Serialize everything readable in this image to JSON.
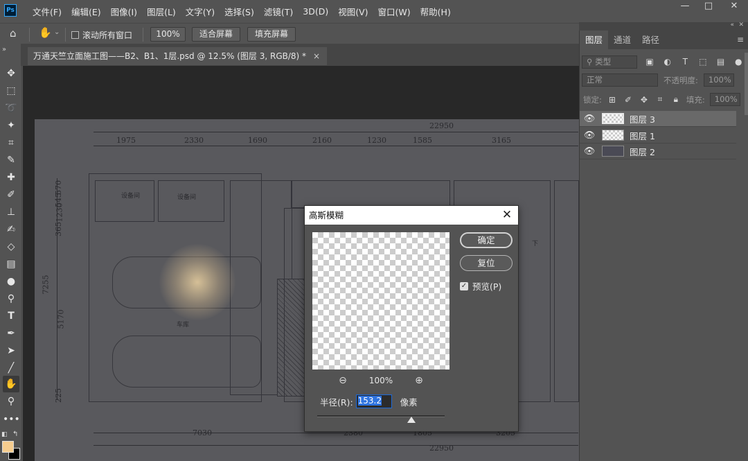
{
  "app": {
    "logo": "Ps"
  },
  "menu": [
    "文件(F)",
    "编辑(E)",
    "图像(I)",
    "图层(L)",
    "文字(Y)",
    "选择(S)",
    "滤镜(T)",
    "3D(D)",
    "视图(V)",
    "窗口(W)",
    "帮助(H)"
  ],
  "window_controls": {
    "minimize": "—",
    "restore": "□",
    "close": "✕"
  },
  "options_bar": {
    "scroll_all_label": "滚动所有窗口",
    "zoom_value": "100%",
    "fit_screen": "适合屏幕",
    "fill_screen": "填充屏幕"
  },
  "document_tab": {
    "title": "万通天竺立面施工图——B2、B1、1层.psd @ 12.5% (图层 3, RGB/8) *",
    "close": "×"
  },
  "toolbar": {
    "expand": "»",
    "tools": [
      "move-tool",
      "marquee-tool",
      "lasso-tool",
      "magic-wand-tool",
      "crop-tool",
      "eyedropper-tool",
      "healing-brush-tool",
      "brush-tool",
      "stamp-tool",
      "history-brush-tool",
      "eraser-tool",
      "gradient-tool",
      "blur-tool",
      "dodge-tool",
      "type-tool",
      "pen-tool",
      "path-select-tool",
      "line-tool",
      "hand-tool",
      "zoom-tool",
      "more-tools"
    ]
  },
  "colors": {
    "foreground": "#f5cc8e",
    "background": "#000000",
    "accent": "#2f74e0"
  },
  "drawing": {
    "top_total": "22950",
    "top_dims": [
      "1975",
      "2330",
      "1690",
      "2160",
      "1230",
      "1585",
      "3165"
    ],
    "bottom_total": "22950",
    "bottom_dims": [
      "7030",
      "2380",
      "1805",
      "3205"
    ],
    "left_dims": [
      "7255",
      "5170",
      "365",
      "1230",
      "545",
      "570",
      "225"
    ],
    "room_labels": [
      "设备间",
      "设备间",
      "车库",
      "下"
    ]
  },
  "dialog": {
    "title": "高斯模糊",
    "close": "✕",
    "ok": "确定",
    "reset": "复位",
    "preview_label": "预览(P)",
    "preview_checked": true,
    "zoom_level": "100%",
    "zoom_out": "⊖",
    "zoom_in": "⊕",
    "radius_label": "半径(R):",
    "radius_value": "153.2",
    "radius_unit": "像素",
    "slider_fraction": 0.74
  },
  "layers_panel": {
    "tabs": [
      "图层",
      "通道",
      "路径"
    ],
    "active_tab": "图层",
    "menu": "≡",
    "filter_placeholder": "类型",
    "blend_mode": "正常",
    "opacity_label": "不透明度:",
    "opacity_value": "100%",
    "lock_label": "锁定:",
    "fill_label": "填充:",
    "fill_value": "100%",
    "layers": [
      {
        "name": "图层 3",
        "thumb": "checker",
        "active": true
      },
      {
        "name": "图层 1",
        "thumb": "checker",
        "active": false
      },
      {
        "name": "图层 2",
        "thumb": "dark",
        "active": false
      }
    ]
  }
}
